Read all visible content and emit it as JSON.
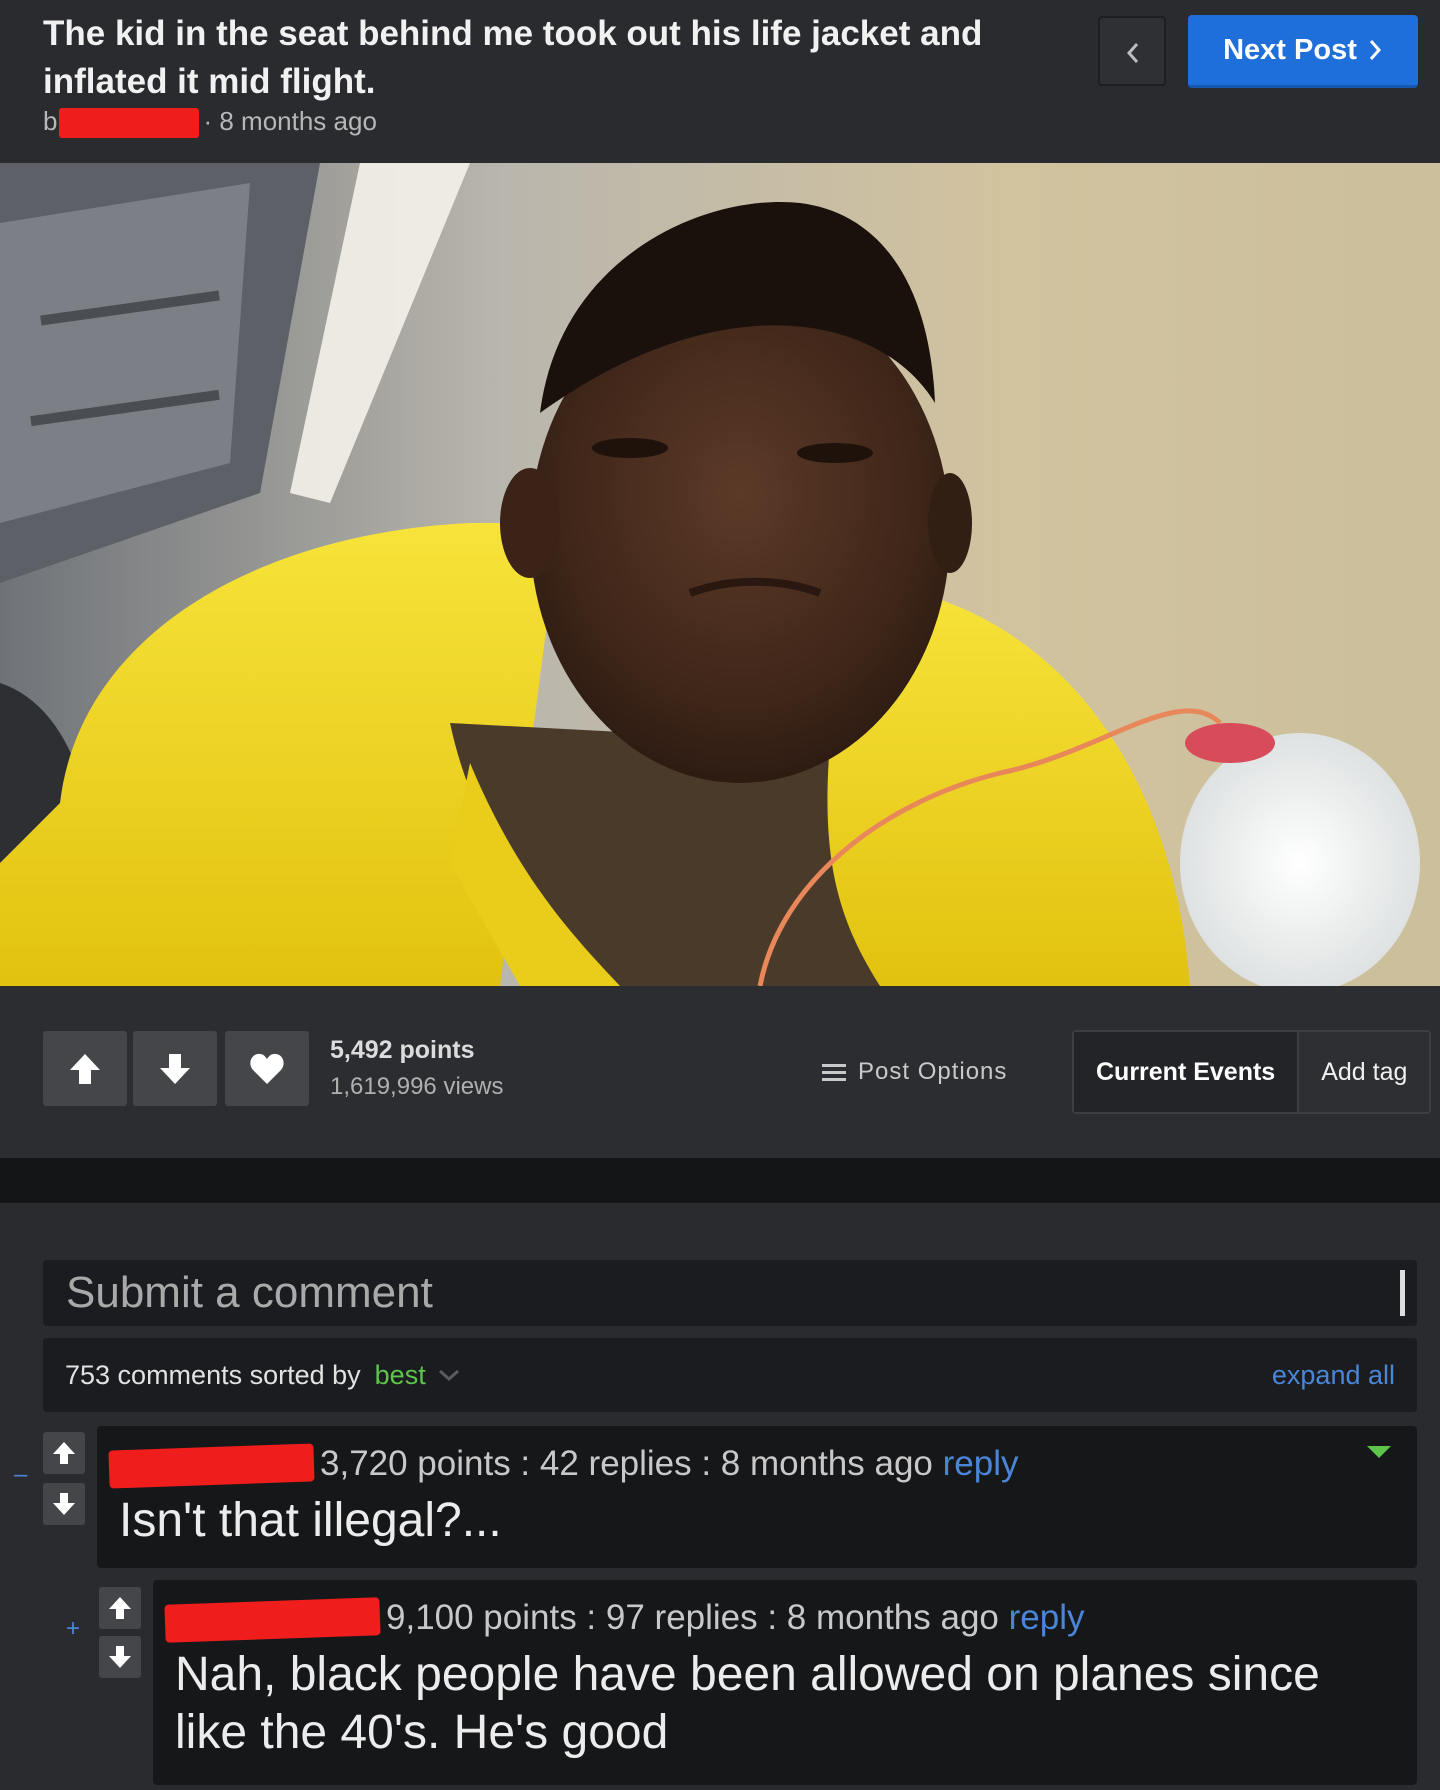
{
  "post": {
    "title": "The kid in the seat behind me took out his life jacket and inflated it mid flight.",
    "by_prefix": "b",
    "time": "· 8 months ago",
    "next_label": "Next Post"
  },
  "actions": {
    "points": "5,492 points",
    "views": "1,619,996 views",
    "post_options": "Post Options",
    "tag": "Current Events",
    "add_tag": "Add tag"
  },
  "comments_section": {
    "placeholder": "Submit a comment",
    "sort_prefix": "753 comments sorted by",
    "sort_value": "best",
    "expand_all": "expand all",
    "items": [
      {
        "meta": "3,720 points : 42 replies : 8 months ago",
        "reply": "reply",
        "text": "Isn't that illegal?...",
        "toggle": "–"
      },
      {
        "meta": "9,100 points : 97 replies : 8 months ago",
        "reply": "reply",
        "text": "Nah, black people have been allowed on planes since like the 40's. He's good",
        "toggle": "+"
      }
    ]
  },
  "colors": {
    "accent_blue": "#1e6fd9",
    "link_blue": "#4a86d8",
    "sort_green": "#5ec54a",
    "redaction": "#f01d1d",
    "life_jacket": "#f2d51c"
  },
  "icons": [
    "chevron-left-icon",
    "chevron-right-icon",
    "upvote-icon",
    "downvote-icon",
    "heart-icon",
    "menu-icon",
    "chevron-down-icon",
    "collapse-caret-icon"
  ]
}
